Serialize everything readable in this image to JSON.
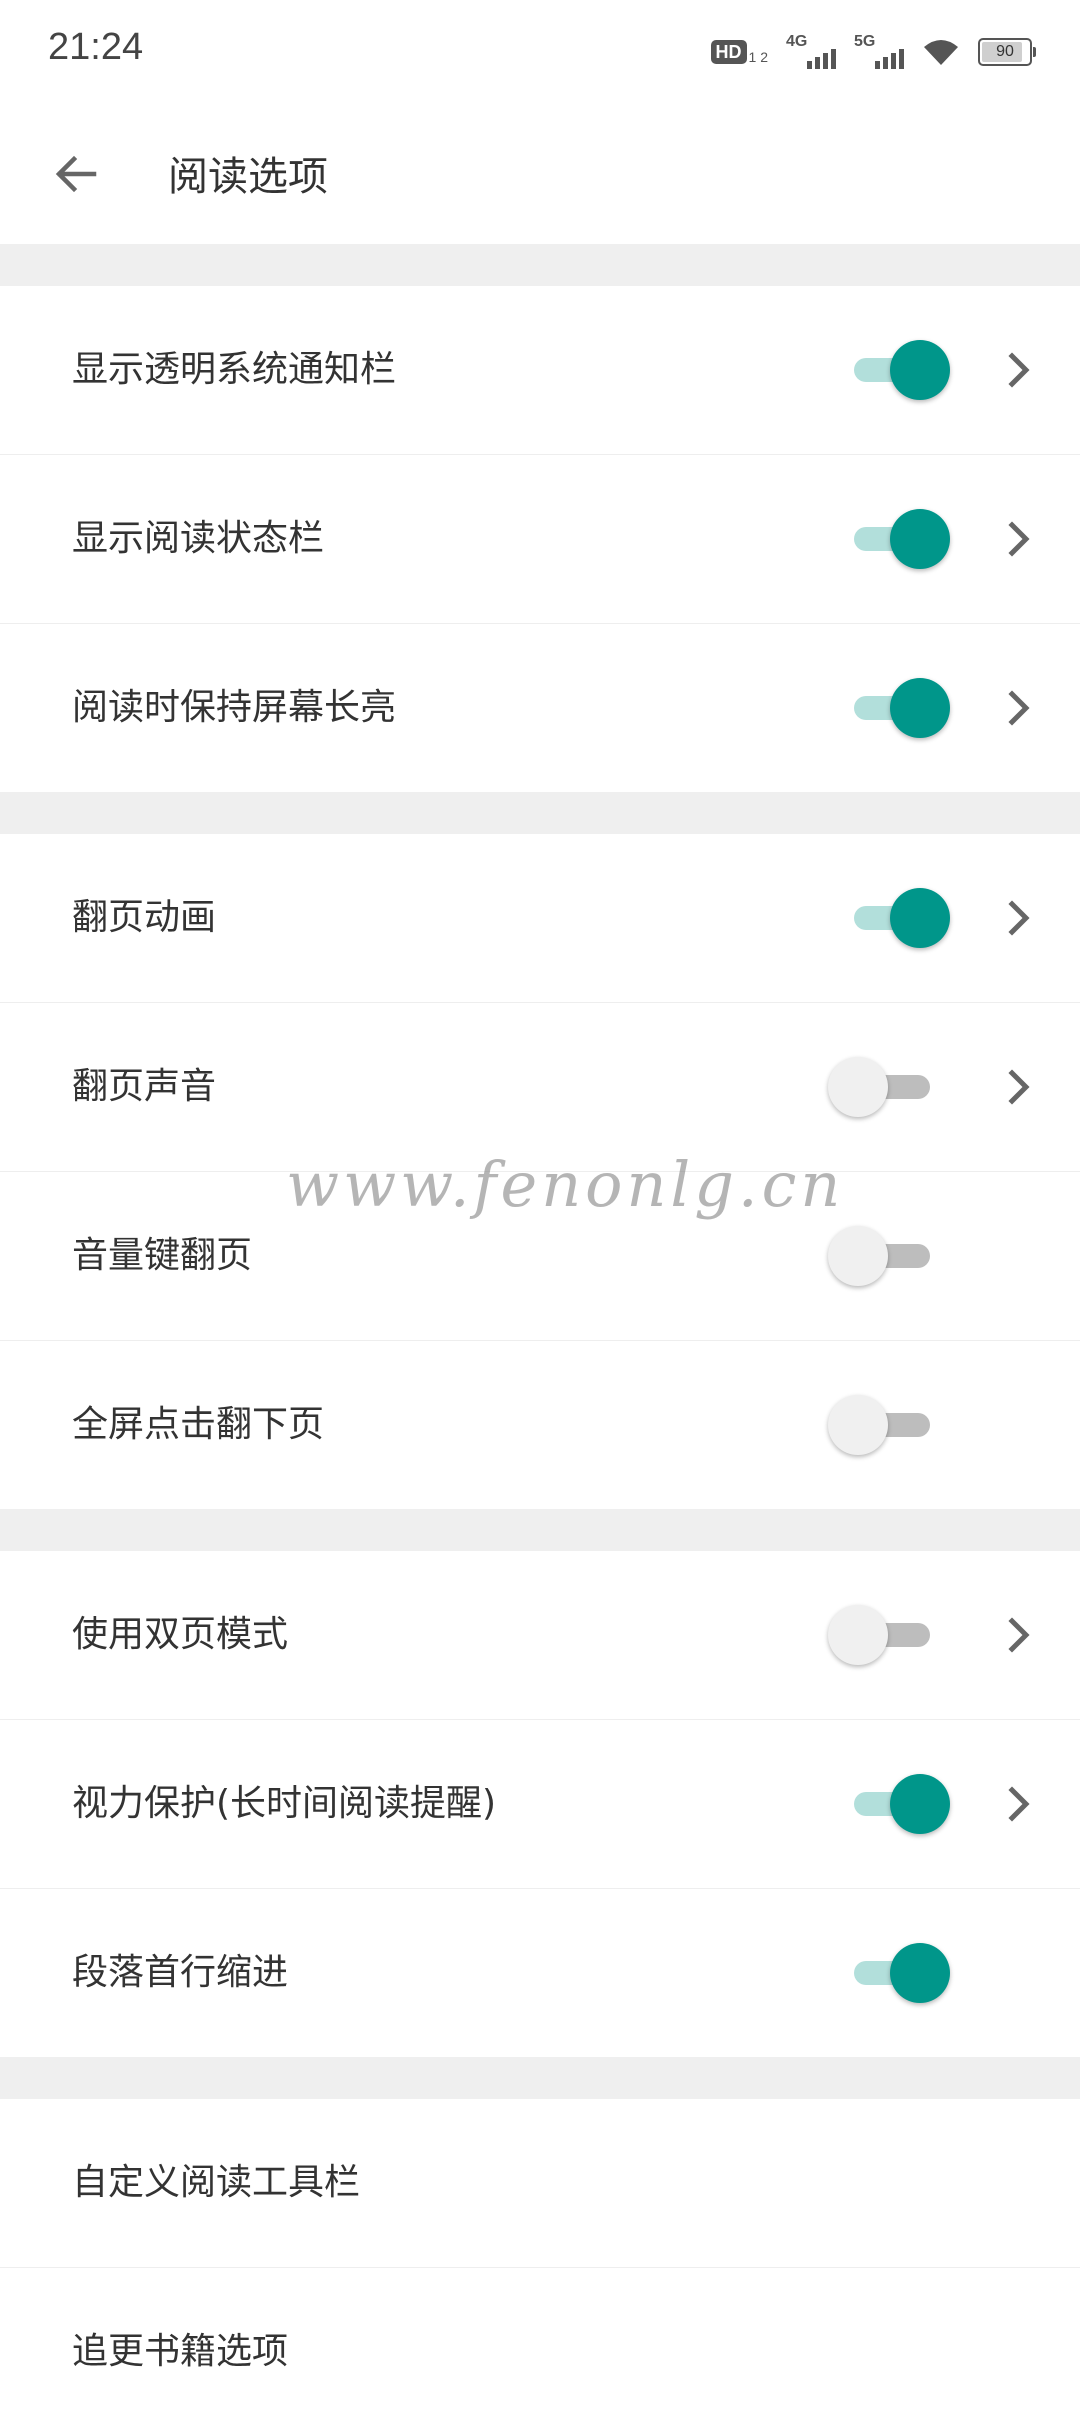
{
  "status_bar": {
    "time": "21:24",
    "hd_badge": "HD",
    "sim_index": "1 2",
    "network_1": "4G",
    "network_2": "5G",
    "battery": "90"
  },
  "app_bar": {
    "back_icon": "arrow-left-icon",
    "title": "阅读选项"
  },
  "sections": [
    {
      "items": [
        {
          "label": "显示透明系统通知栏",
          "switch": true,
          "chevron": true
        },
        {
          "label": "显示阅读状态栏",
          "switch": true,
          "chevron": true
        },
        {
          "label": "阅读时保持屏幕长亮",
          "switch": true,
          "chevron": true
        }
      ]
    },
    {
      "items": [
        {
          "label": "翻页动画",
          "switch": true,
          "chevron": true
        },
        {
          "label": "翻页声音",
          "switch": false,
          "chevron": true
        },
        {
          "label": "音量键翻页",
          "switch": false,
          "chevron": false
        },
        {
          "label": "全屏点击翻下页",
          "switch": false,
          "chevron": false
        }
      ]
    },
    {
      "items": [
        {
          "label": "使用双页模式",
          "switch": false,
          "chevron": true
        },
        {
          "label": "视力保护(长时间阅读提醒)",
          "switch": true,
          "chevron": true
        },
        {
          "label": "段落首行缩进",
          "switch": true,
          "chevron": false
        }
      ]
    },
    {
      "items": [
        {
          "label": "自定义阅读工具栏"
        },
        {
          "label": "追更书籍选项"
        }
      ]
    }
  ],
  "watermark": "www.fenonlg.cn",
  "colors": {
    "accent": "#00968a",
    "accent_track": "#b2dfdb",
    "off_thumb": "#f0f0f0",
    "off_track": "#bdbdbd",
    "divider": "#efefef",
    "text": "#333333"
  }
}
